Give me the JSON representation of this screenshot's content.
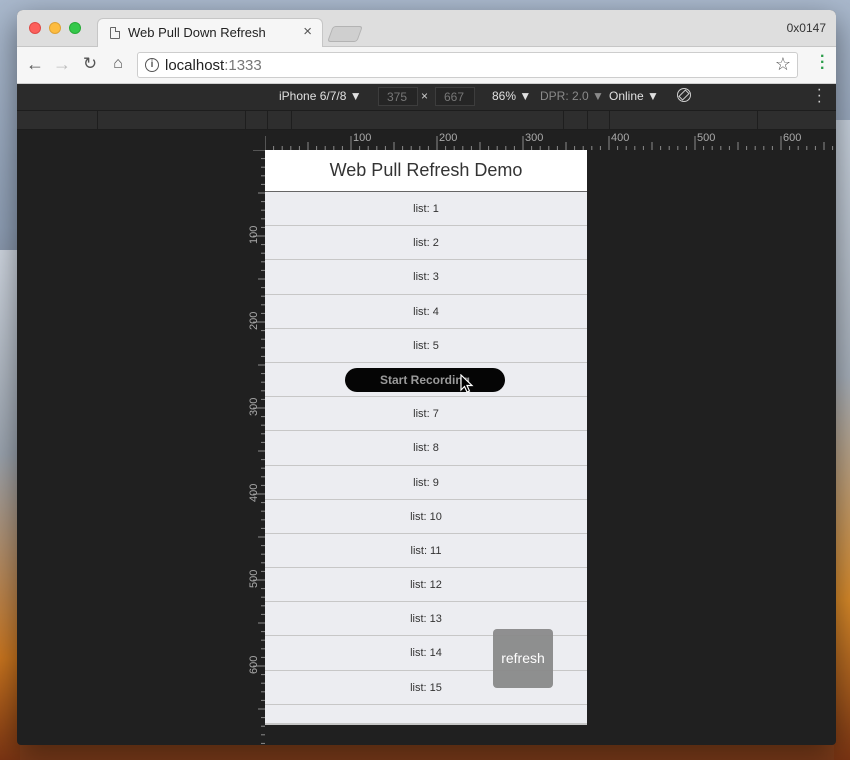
{
  "browser": {
    "tab_title": "Web Pull Down Refresh",
    "tab_close": "×",
    "window_id": "0x0147",
    "url_host": "localhost",
    "url_port": ":1333"
  },
  "devtools": {
    "device": "iPhone 6/7/8 ▼",
    "width": "375",
    "times": "×",
    "height": "667",
    "zoom": "86% ▼",
    "dpr": "DPR: 2.0 ▼",
    "network": "Online ▼",
    "rulers_top": [
      "100",
      "200",
      "300",
      "400",
      "500",
      "600"
    ],
    "rulers_left": [
      "100",
      "200",
      "300",
      "400",
      "500",
      "600"
    ]
  },
  "app": {
    "title": "Web Pull Refresh Demo",
    "items": [
      "list: 1",
      "list: 2",
      "list: 3",
      "list: 4",
      "list: 5",
      "",
      "list: 7",
      "list: 8",
      "list: 9",
      "list: 10",
      "list: 11",
      "list: 12",
      "list: 13",
      "list: 14",
      "list: 15"
    ],
    "refresh_label": "refresh"
  },
  "overlay": {
    "record_label": "Start Recording"
  },
  "colors": {
    "list_bg": "#ecedf1",
    "refresh_bg": "#8a8a8a",
    "devtools_bg": "#202020"
  }
}
